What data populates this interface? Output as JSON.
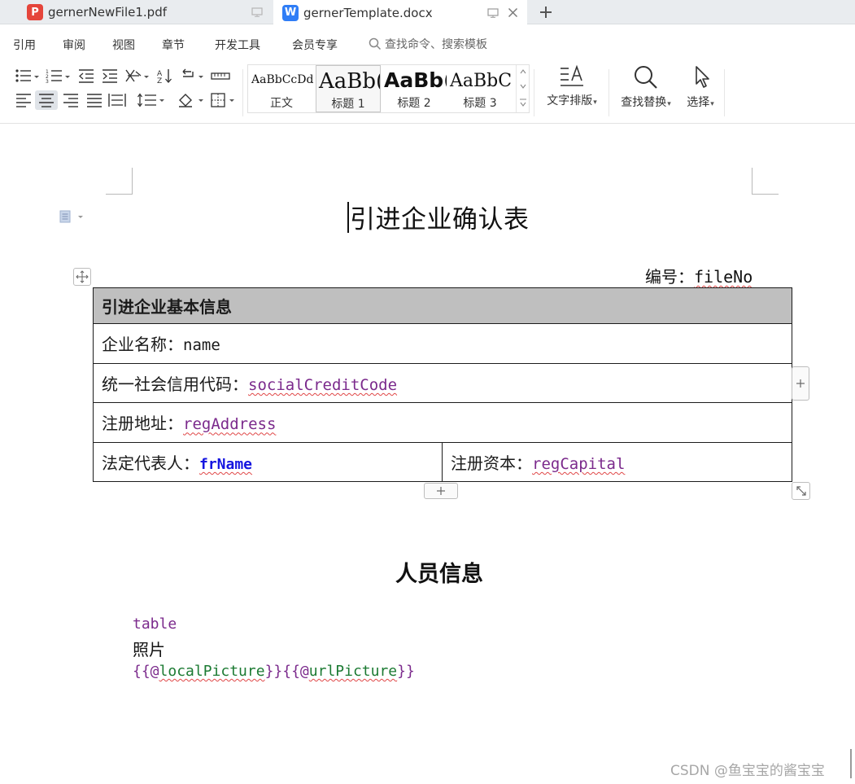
{
  "tabs": [
    {
      "title": "gernerNewFile1.pdf",
      "app": "pdf"
    },
    {
      "title": "gernerTemplate.docx",
      "app": "wps",
      "active": true
    }
  ],
  "menu": {
    "items": [
      "引用",
      "审阅",
      "视图",
      "章节",
      "开发工具",
      "会员专享"
    ],
    "search_placeholder": "查找命令、搜索模板"
  },
  "ribbon": {
    "styles": [
      {
        "sample": "AaBbCcDd",
        "name": "正文"
      },
      {
        "sample": "AaBb(",
        "name": "标题 1"
      },
      {
        "sample": "AaBb(",
        "name": "标题 2"
      },
      {
        "sample": "AaBbCc",
        "name": "标题 3"
      }
    ],
    "text_layout_label": "文字排版",
    "find_replace_label": "查找替换",
    "select_label": "选择"
  },
  "document": {
    "title": "引进企业确认表",
    "file_no_label": "编号：",
    "file_no_field": "fileNo",
    "table": {
      "header": "引进企业基本信息",
      "rows": [
        {
          "label": "企业名称：",
          "field": "name"
        },
        {
          "label": "统一社会信用代码：",
          "field": "socialCreditCode"
        },
        {
          "label": "注册地址：",
          "field": "regAddress"
        }
      ],
      "last_row": [
        {
          "label": "法定代表人：",
          "field": "frName"
        },
        {
          "label": "注册资本：",
          "field": "regCapital"
        }
      ]
    },
    "section_title": "人员信息",
    "table_placeholder": "table",
    "photo_label": "照片",
    "pictures": {
      "open1": "{{@",
      "field1": "localPicture",
      "close1": "}}",
      "open2": "{{@",
      "field2": "urlPicture",
      "close2": "}}"
    }
  },
  "watermark": "CSDN @鱼宝宝的酱宝宝",
  "colors": {
    "field_purple": "#7b2a8c",
    "field_blue": "#1515e0",
    "field_green": "#1b7a32",
    "table_header_bg": "#bfbfbf",
    "spell_squiggle": "#e04646"
  }
}
